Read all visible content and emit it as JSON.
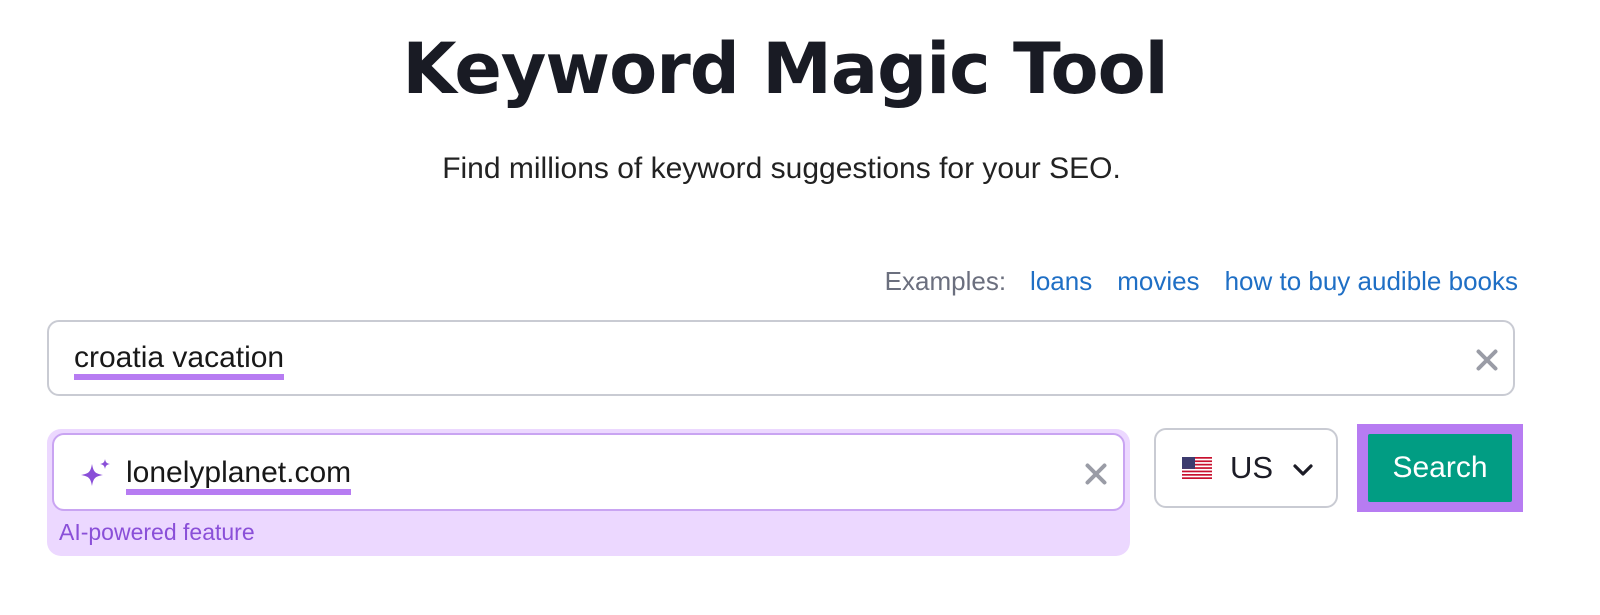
{
  "header": {
    "title": "Keyword Magic Tool",
    "subtitle": "Find millions of keyword suggestions for your SEO."
  },
  "examples": {
    "label": "Examples:",
    "links": [
      "loans",
      "movies",
      "how to buy audible books"
    ]
  },
  "keyword_input": {
    "value": "croatia vacation",
    "clear_icon": "close-icon"
  },
  "domain_input": {
    "value": "lonelyplanet.com",
    "leading_icon": "sparkle-icon",
    "clear_icon": "close-icon",
    "note": "AI-powered feature"
  },
  "country_select": {
    "flag_icon": "us-flag-icon",
    "selected": "US",
    "dropdown_icon": "chevron-down-icon"
  },
  "search_button": {
    "label": "Search"
  },
  "colors": {
    "accent_purple": "#b77cf2",
    "ai_panel_bg": "#ecd8ff",
    "search_green": "#019d83",
    "link_blue": "#1f6fc5"
  }
}
